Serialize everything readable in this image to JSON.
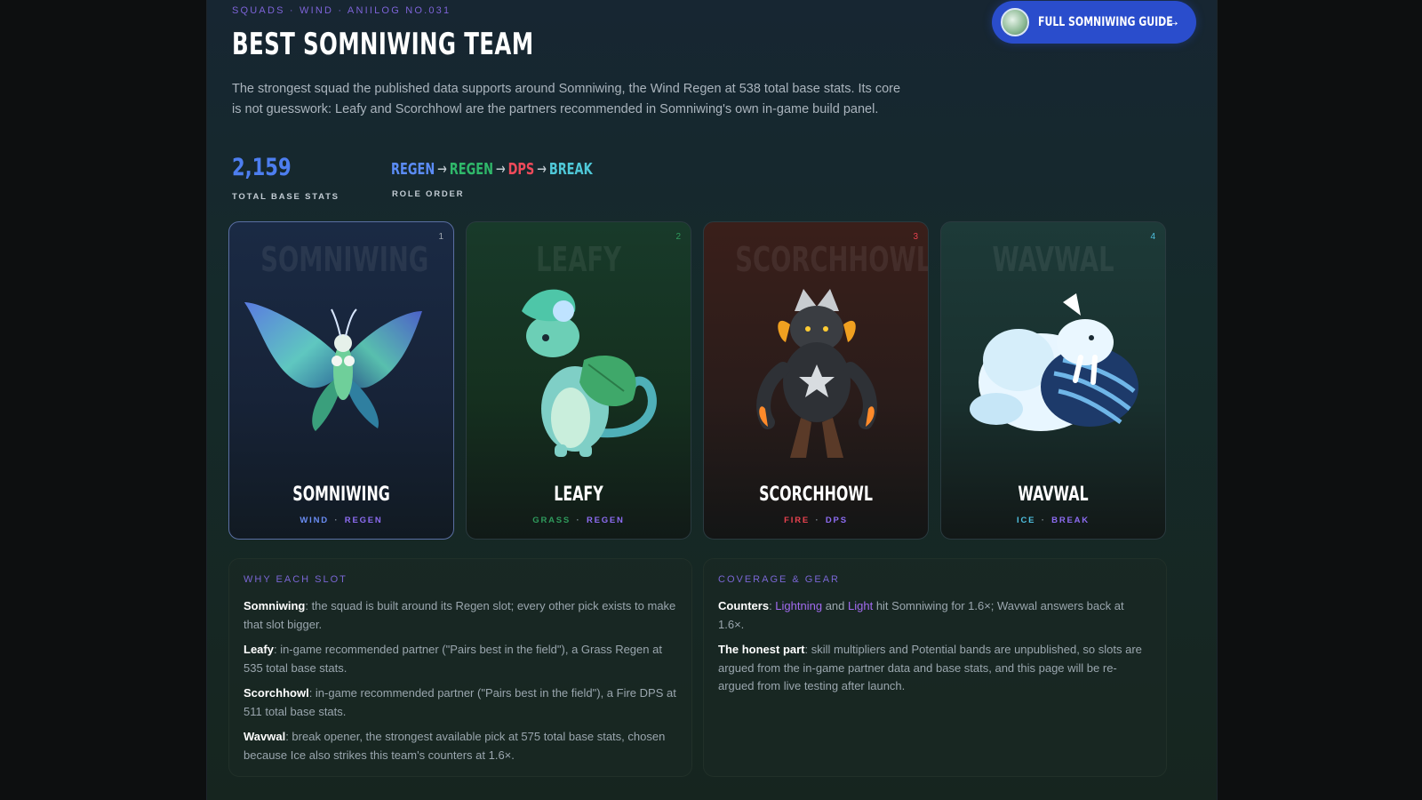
{
  "header": {
    "eyebrow": "SQUADS · WIND · ANIILOG NO.031",
    "title": "BEST SOMNIWING TEAM",
    "guide_button": "FULL SOMNIWING GUIDE",
    "guide_arrow": "→",
    "intro": "The strongest squad the published data supports around Somniwing, the Wind Regen at 538 total base stats. Its core is not guesswork: Leafy and Scorchhowl are the partners recommended in Somniwing's own in-game build panel."
  },
  "stats": {
    "total_value": "2,159",
    "total_label": "TOTAL BASE STATS",
    "roles": [
      {
        "name": "REGEN",
        "color": "#5b8cf7"
      },
      {
        "name": "REGEN",
        "color": "#2fb86a"
      },
      {
        "name": "DPS",
        "color": "#ee4a5a"
      },
      {
        "name": "BREAK",
        "color": "#4fc8d8"
      }
    ],
    "arrow": "→",
    "roles_label": "ROLE ORDER"
  },
  "cards": [
    {
      "num": "1",
      "name": "SOMNIWING",
      "bg_name": "SOMNIWING",
      "element": "WIND",
      "element_color": "#6a8df4",
      "role": "REGEN",
      "role_color": "#8d6cf2",
      "num_color": "#a0a8b0",
      "icon": "moth-creature-art"
    },
    {
      "num": "2",
      "name": "LEAFY",
      "bg_name": "LEAFY",
      "element": "GRASS",
      "element_color": "#2f9a5c",
      "role": "REGEN",
      "role_color": "#8d6cf2",
      "num_color": "#2f9a5c",
      "icon": "leaf-dragon-art"
    },
    {
      "num": "3",
      "name": "SCORCHHOWL",
      "bg_name": "SCORCHHOWL",
      "element": "FIRE",
      "element_color": "#e8424f",
      "role": "DPS",
      "role_color": "#8d6cf2",
      "num_color": "#e8424f",
      "icon": "fire-wolf-art"
    },
    {
      "num": "4",
      "name": "WAVWAL",
      "bg_name": "WAVWAL",
      "element": "ICE",
      "element_color": "#4fc0e0",
      "role": "BREAK",
      "role_color": "#8d6cf2",
      "num_color": "#4fc0e0",
      "icon": "ice-walrus-art"
    }
  ],
  "why_panel": {
    "title": "WHY EACH SLOT",
    "items": [
      {
        "label": "Somniwing",
        "text": ": the squad is built around its Regen slot; every other pick exists to make that slot bigger."
      },
      {
        "label": "Leafy",
        "text": ": in-game recommended partner (\"Pairs best in the field\"), a Grass Regen at 535 total base stats."
      },
      {
        "label": "Scorchhowl",
        "text": ": in-game recommended partner (\"Pairs best in the field\"), a Fire DPS at 511 total base stats."
      },
      {
        "label": "Wavwal",
        "text": ": break opener, the strongest available pick at 575 total base stats, chosen because Ice also strikes this team's counters at 1.6×."
      }
    ]
  },
  "coverage_panel": {
    "title": "COVERAGE & GEAR",
    "counters_label": "Counters",
    "counters_pre": ": ",
    "counter_1": "Lightning",
    "counters_and": " and ",
    "counter_2": "Light",
    "counters_post": " hit Somniwing for 1.6×; Wavwal answers back at 1.6×.",
    "honest_label": "The honest part",
    "honest_text": ": skill multipliers and Potential bands are unpublished, so slots are argued from the in-game partner data and base stats, and this page will be re-argued from live testing after launch."
  }
}
